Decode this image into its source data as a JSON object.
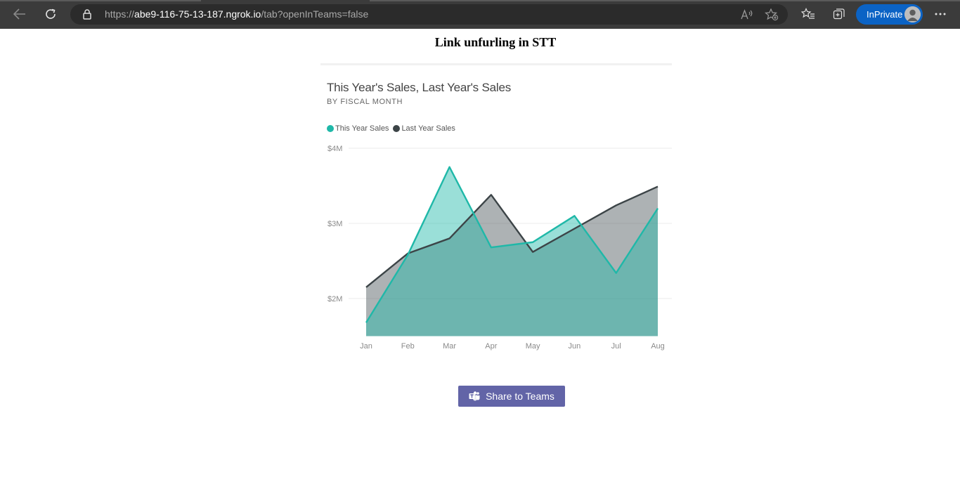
{
  "browser": {
    "url_prefix": "https://",
    "url_host": "abe9-116-75-13-187.ngrok.io",
    "url_path": "/tab?openInTeams=false",
    "inprivate_label": "InPrivate"
  },
  "page": {
    "title": "Link unfurling in STT",
    "share_button_label": "Share to Teams"
  },
  "chart_data": {
    "type": "area",
    "title": "This Year's Sales, Last Year's Sales",
    "subtitle": "BY FISCAL MONTH",
    "categories": [
      "Jan",
      "Feb",
      "Mar",
      "Apr",
      "May",
      "Jun",
      "Jul",
      "Aug"
    ],
    "yticks": [
      "$4M",
      "$3M",
      "$2M"
    ],
    "ytick_values": [
      4,
      3,
      2
    ],
    "ylim": [
      1.5,
      4
    ],
    "grid": true,
    "legend_position": "top-left",
    "series": [
      {
        "name": "This Year Sales",
        "color": "#1fb8a8",
        "values": [
          1.68,
          2.58,
          3.75,
          2.68,
          2.75,
          3.1,
          2.34,
          3.2
        ]
      },
      {
        "name": "Last Year Sales",
        "color": "#3c4447",
        "values": [
          2.15,
          2.6,
          2.8,
          3.38,
          2.62,
          2.93,
          3.24,
          3.49
        ]
      }
    ]
  },
  "colors": {
    "chrome_bg": "#3b3b3b",
    "address_bg": "#2b2b2b",
    "inprivate_bg": "#0b63c5",
    "teams_purple": "#6264a7"
  }
}
